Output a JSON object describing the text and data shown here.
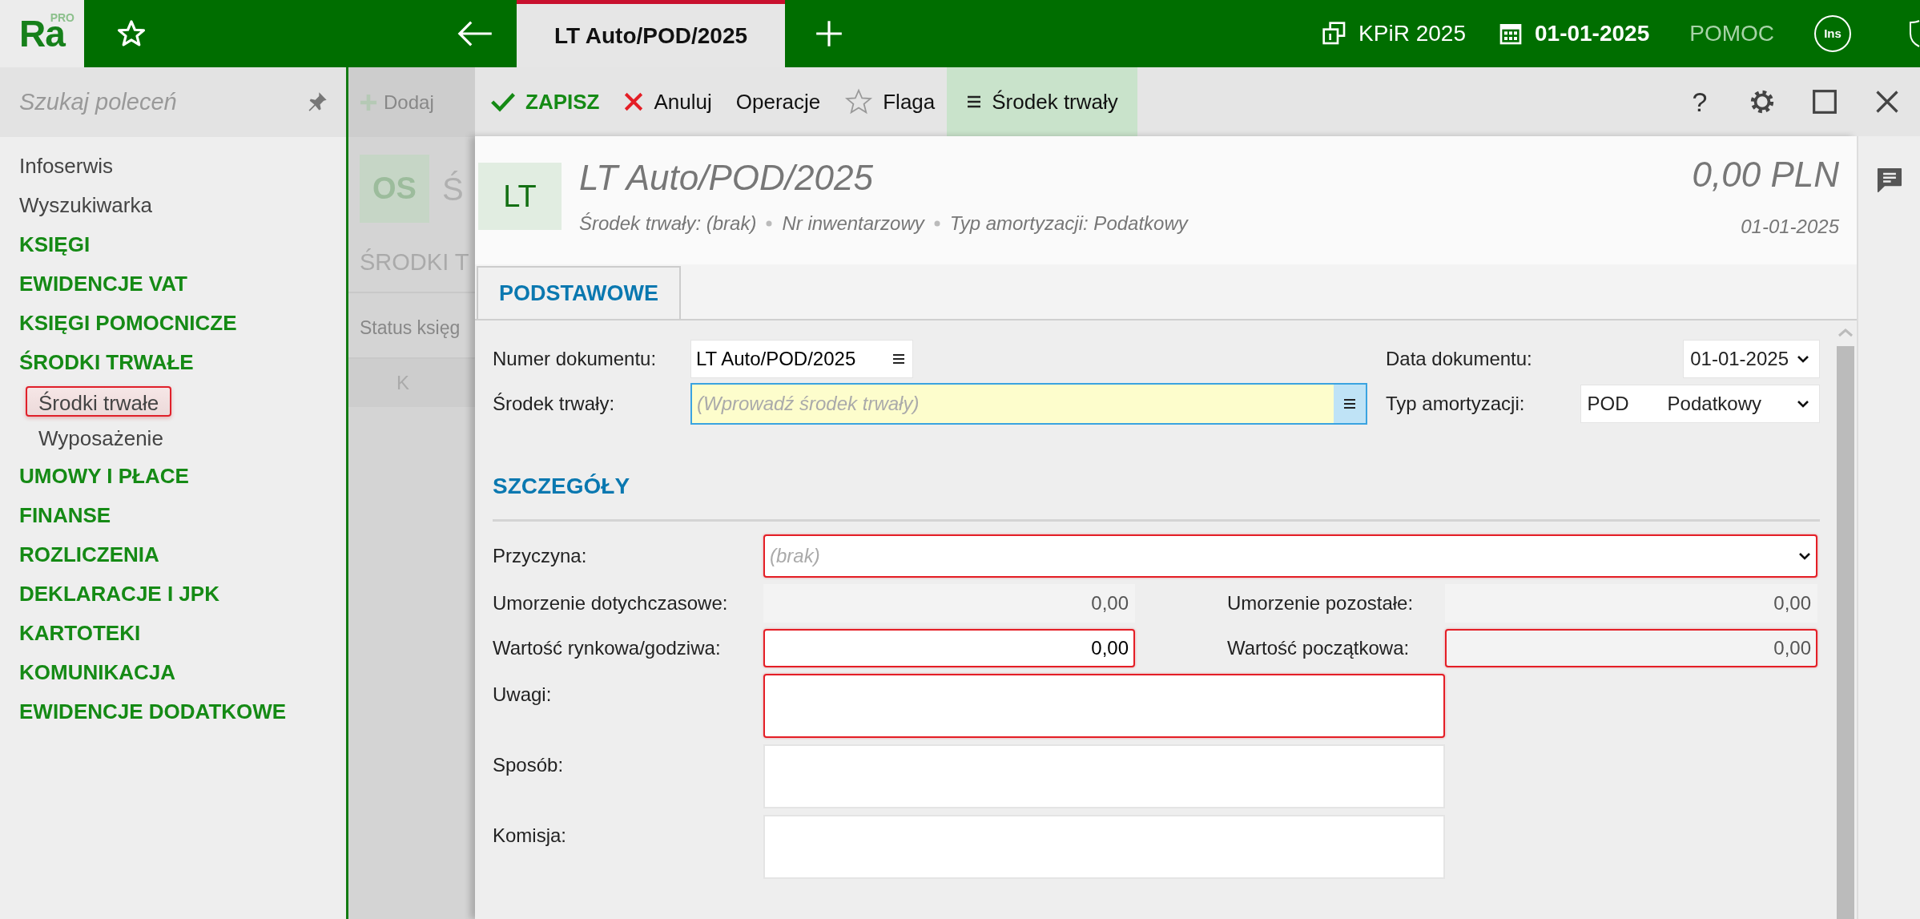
{
  "top_bar": {
    "logo": {
      "text": "Ra",
      "badge": "PRO"
    },
    "tabs": [
      {
        "label": "LT Auto/POD/2025",
        "selected": true
      }
    ],
    "book": "KPiR 2025",
    "date": "01-01-2025",
    "help": "POMOC",
    "user": "Ins"
  },
  "sidebar": {
    "search": {
      "placeholder": "Szukaj poleceń"
    },
    "items": [
      {
        "label": "Infoserwis",
        "kind": "link"
      },
      {
        "label": "Wyszukiwarka",
        "kind": "link"
      },
      {
        "label": "KSIĘGI",
        "kind": "group"
      },
      {
        "label": "EWIDENCJE VAT",
        "kind": "group"
      },
      {
        "label": "KSIĘGI POMOCNICZE",
        "kind": "group"
      },
      {
        "label": "ŚRODKI TRWAŁE",
        "kind": "group",
        "children": [
          {
            "label": "Środki trwałe",
            "selected": true
          },
          {
            "label": "Wyposażenie",
            "selected": false
          }
        ]
      },
      {
        "label": "UMOWY I PŁACE",
        "kind": "group"
      },
      {
        "label": "FINANSE",
        "kind": "group"
      },
      {
        "label": "ROZLICZENIA",
        "kind": "group"
      },
      {
        "label": "DEKLARACJE I JPK",
        "kind": "group"
      },
      {
        "label": "KARTOTEKI",
        "kind": "group"
      },
      {
        "label": "KOMUNIKACJA",
        "kind": "group"
      },
      {
        "label": "EWIDENCJE DODATKOWE",
        "kind": "group"
      }
    ]
  },
  "background_panel": {
    "toolbar_button": "Dodaj",
    "badge": "OS",
    "title": "Ś",
    "section": "ŚRODKI T",
    "filter": "Status księg",
    "column": "K"
  },
  "dialog": {
    "toolbar": [
      {
        "kind": "save",
        "label": "ZAPISZ",
        "selected": false
      },
      {
        "kind": "cancel",
        "label": "Anuluj",
        "selected": false
      },
      {
        "kind": "plain",
        "label": "Operacje",
        "selected": false
      },
      {
        "kind": "flag",
        "label": "Flaga",
        "selected": false
      },
      {
        "kind": "menu",
        "label": "Środek trwały",
        "selected": true
      }
    ],
    "help": "?",
    "header": {
      "badge": "LT",
      "title": "LT Auto/POD/2025",
      "meta": [
        "Środek trwały: (brak)",
        "Nr inwentarzowy",
        "Typ amortyzacji: Podatkowy"
      ],
      "amount": "0,00 PLN",
      "date": "01-01-2025"
    },
    "tabs": [
      {
        "label": "PODSTAWOWE",
        "selected": true
      }
    ],
    "main_fields": [
      {
        "label": "Numer dokumentu:",
        "kind": "picker",
        "value": "LT Auto/POD/2025",
        "focused": false
      },
      {
        "label": "Data dokumentu:",
        "kind": "select",
        "value": "01-01-2025"
      },
      {
        "label": "Środek trwały:",
        "kind": "picker",
        "placeholder": "(Wprowadź środek trwały)",
        "focused": true
      },
      {
        "label": "Typ amortyzacji:",
        "kind": "select",
        "code": "POD",
        "value": "Podatkowy"
      }
    ],
    "section": "SZCZEGÓŁY",
    "detail_fields": [
      {
        "label": "Przyczyna:",
        "kind": "select",
        "placeholder": "(brak)",
        "invalid": true
      },
      {
        "label": "Umorzenie dotychczasowe:",
        "kind": "number",
        "value": "0,00",
        "invalid": false,
        "readonly": true
      },
      {
        "label": "Umorzenie pozostałe:",
        "kind": "number",
        "value": "0,00",
        "invalid": false,
        "readonly": true
      },
      {
        "label": "Wartość rynkowa/godziwa:",
        "kind": "number",
        "value": "0,00",
        "invalid": true,
        "readonly": false
      },
      {
        "label": "Wartość początkowa:",
        "kind": "number",
        "value": "0,00",
        "invalid": true,
        "readonly": true
      },
      {
        "label": "Uwagi:",
        "kind": "text",
        "invalid": true
      },
      {
        "label": "Sposób:",
        "kind": "text",
        "invalid": false
      },
      {
        "label": "Komisja:",
        "kind": "text",
        "invalid": false
      }
    ]
  }
}
